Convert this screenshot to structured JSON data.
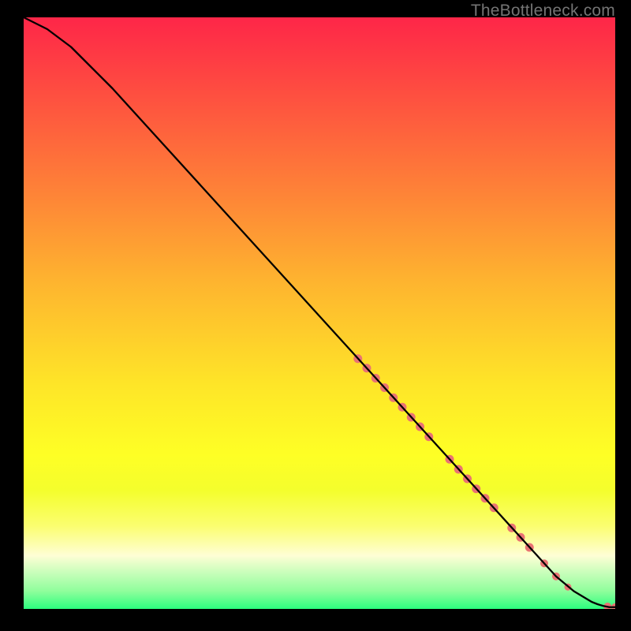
{
  "credit": "TheBottleneck.com",
  "colors": {
    "black": "#000000",
    "grad_top": "#fe2648",
    "grad_1": "#fe553f",
    "grad_2": "#fe8437",
    "grad_3": "#feb52f",
    "grad_4": "#fee528",
    "grad_5": "#feff25",
    "grad_6": "#f4fe2d",
    "grad_7": "#fbfe70",
    "grad_8": "#fefed5",
    "grad_9": "#c6feb9",
    "grad_10": "#8ffe9c",
    "grad_bottom": "#2cfe7e",
    "line": "#000000",
    "marker": "#e97373"
  },
  "chart_data": {
    "type": "line",
    "title": "",
    "xlabel": "",
    "ylabel": "",
    "xlim": [
      0,
      100
    ],
    "ylim": [
      0,
      100
    ],
    "grid": false,
    "background": "rainbow-vertical-gradient",
    "series": [
      {
        "name": "curve",
        "x": [
          0,
          2,
          4,
          6,
          8,
          10,
          15,
          20,
          30,
          40,
          50,
          60,
          70,
          80,
          85,
          90,
          93,
          95,
          96,
          97,
          98,
          99,
          100
        ],
        "y": [
          100,
          99,
          98,
          96.5,
          95,
          93,
          88,
          82.5,
          71.5,
          60.5,
          49.5,
          38.5,
          27.5,
          16.5,
          11,
          5.5,
          3,
          1.8,
          1.2,
          0.8,
          0.5,
          0.3,
          0.3
        ]
      }
    ],
    "markers": [
      {
        "x": 56.5,
        "y": 42.3,
        "r": 5.5
      },
      {
        "x": 58.0,
        "y": 40.7,
        "r": 5.5
      },
      {
        "x": 59.5,
        "y": 39.0,
        "r": 5.5
      },
      {
        "x": 61.0,
        "y": 37.4,
        "r": 5.5
      },
      {
        "x": 62.5,
        "y": 35.7,
        "r": 5.5
      },
      {
        "x": 64.0,
        "y": 34.1,
        "r": 5.5
      },
      {
        "x": 65.5,
        "y": 32.4,
        "r": 5.5
      },
      {
        "x": 67.0,
        "y": 30.8,
        "r": 5.5
      },
      {
        "x": 68.5,
        "y": 29.1,
        "r": 5.5
      },
      {
        "x": 72.0,
        "y": 25.3,
        "r": 5.5
      },
      {
        "x": 73.5,
        "y": 23.6,
        "r": 5.5
      },
      {
        "x": 75.0,
        "y": 22.0,
        "r": 5.5
      },
      {
        "x": 76.5,
        "y": 20.3,
        "r": 5.5
      },
      {
        "x": 78.0,
        "y": 18.7,
        "r": 5.5
      },
      {
        "x": 79.5,
        "y": 17.1,
        "r": 5.5
      },
      {
        "x": 82.5,
        "y": 13.7,
        "r": 5.5
      },
      {
        "x": 84.0,
        "y": 12.1,
        "r": 5.5
      },
      {
        "x": 85.5,
        "y": 10.4,
        "r": 5.5
      },
      {
        "x": 88.0,
        "y": 7.7,
        "r": 5.0
      },
      {
        "x": 90.0,
        "y": 5.5,
        "r": 5.0
      },
      {
        "x": 92.0,
        "y": 3.7,
        "r": 4.5
      },
      {
        "x": 98.7,
        "y": 0.4,
        "r": 5.0
      },
      {
        "x": 100.0,
        "y": 0.3,
        "r": 5.0
      }
    ]
  }
}
